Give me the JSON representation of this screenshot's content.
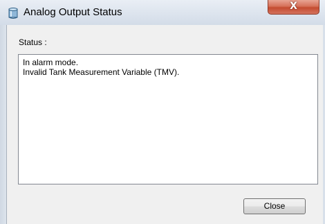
{
  "window": {
    "title": "Analog Output Status",
    "close_glyph": "X",
    "app_icon": "cylinder-tank-icon"
  },
  "content": {
    "status_label": "Status :",
    "status_lines": [
      "In alarm mode.",
      "Invalid Tank Measurement Variable (TMV)."
    ]
  },
  "buttons": {
    "close_label": "Close"
  },
  "colors": {
    "client_background": "#f0f0f0",
    "close_x_red": "#c44b30"
  }
}
